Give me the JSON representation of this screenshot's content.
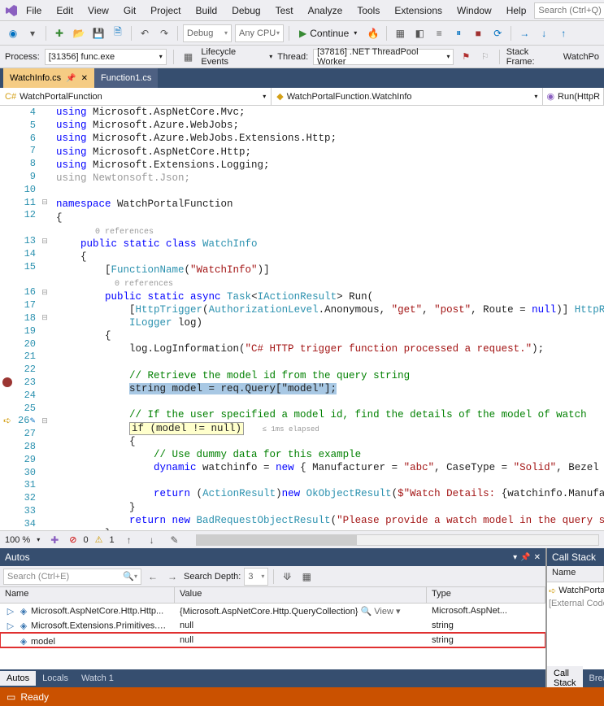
{
  "menu": {
    "items": [
      "File",
      "Edit",
      "View",
      "Git",
      "Project",
      "Build",
      "Debug",
      "Test",
      "Analyze",
      "Tools",
      "Extensions",
      "Window",
      "Help"
    ],
    "search_placeholder": "Search (Ctrl+Q)"
  },
  "toolbar": {
    "config": "Debug",
    "platform": "Any CPU",
    "continue": "Continue"
  },
  "process_row": {
    "process_lbl": "Process:",
    "process_val": "[31356] func.exe",
    "lifecycle": "Lifecycle Events",
    "thread_lbl": "Thread:",
    "thread_val": "[37816] .NET ThreadPool Worker",
    "stackframe_lbl": "Stack Frame:",
    "stackframe_val": "WatchPo"
  },
  "tabs": {
    "active": "WatchInfo.cs",
    "other": "Function1.cs"
  },
  "nav": {
    "left": "WatchPortalFunction",
    "mid": "WatchPortalFunction.WatchInfo",
    "right": "Run(HttpR"
  },
  "code": {
    "lines": [
      {
        "n": 4,
        "seg": [
          {
            "t": "using ",
            "c": "kw"
          },
          {
            "t": "Microsoft.AspNetCore.Mvc;"
          }
        ]
      },
      {
        "n": 5,
        "seg": [
          {
            "t": "using ",
            "c": "kw"
          },
          {
            "t": "Microsoft.Azure.WebJobs;"
          }
        ]
      },
      {
        "n": 6,
        "seg": [
          {
            "t": "using ",
            "c": "kw"
          },
          {
            "t": "Microsoft.Azure.WebJobs.Extensions.Http;"
          }
        ]
      },
      {
        "n": 7,
        "seg": [
          {
            "t": "using ",
            "c": "kw"
          },
          {
            "t": "Microsoft.AspNetCore.Http;"
          }
        ]
      },
      {
        "n": 8,
        "seg": [
          {
            "t": "using ",
            "c": "kw"
          },
          {
            "t": "Microsoft.Extensions.Logging;"
          }
        ]
      },
      {
        "n": 9,
        "seg": [
          {
            "t": "using ",
            "c": "faded"
          },
          {
            "t": "Newtonsoft.Json;",
            "c": "faded"
          }
        ]
      },
      {
        "n": 10,
        "seg": [
          {
            "t": ""
          }
        ]
      },
      {
        "n": 11,
        "fold": "-",
        "seg": [
          {
            "t": "namespace ",
            "c": "kw"
          },
          {
            "t": "WatchPortalFunction"
          }
        ]
      },
      {
        "n": 12,
        "seg": [
          {
            "t": "{"
          }
        ]
      },
      {
        "n": "",
        "lens": true,
        "seg": [
          {
            "t": "        0 references",
            "c": "ref-lens"
          }
        ]
      },
      {
        "n": 13,
        "fold": "-",
        "seg": [
          {
            "t": "    public static class ",
            "c": "kw"
          },
          {
            "t": "WatchInfo",
            "c": "type"
          }
        ]
      },
      {
        "n": 14,
        "seg": [
          {
            "t": "    {"
          }
        ]
      },
      {
        "n": 15,
        "seg": [
          {
            "t": "        ["
          },
          {
            "t": "FunctionName",
            "c": "type"
          },
          {
            "t": "("
          },
          {
            "t": "\"WatchInfo\"",
            "c": "str"
          },
          {
            "t": ")]"
          }
        ]
      },
      {
        "n": "",
        "lens": true,
        "seg": [
          {
            "t": "            0 references",
            "c": "ref-lens"
          }
        ]
      },
      {
        "n": 16,
        "fold": "-",
        "seg": [
          {
            "t": "        public static async ",
            "c": "kw"
          },
          {
            "t": "Task",
            "c": "type"
          },
          {
            "t": "<"
          },
          {
            "t": "IActionResult",
            "c": "type"
          },
          {
            "t": "> "
          },
          {
            "t": "Run",
            "c": ""
          },
          {
            "t": "("
          }
        ]
      },
      {
        "n": 17,
        "seg": [
          {
            "t": "            ["
          },
          {
            "t": "HttpTrigger",
            "c": "type"
          },
          {
            "t": "("
          },
          {
            "t": "AuthorizationLevel",
            "c": "type"
          },
          {
            "t": ".Anonymous, "
          },
          {
            "t": "\"get\"",
            "c": "str"
          },
          {
            "t": ", "
          },
          {
            "t": "\"post\"",
            "c": "str"
          },
          {
            "t": ", Route = "
          },
          {
            "t": "null",
            "c": "kw"
          },
          {
            "t": ")] "
          },
          {
            "t": "HttpReque",
            "c": "type"
          }
        ]
      },
      {
        "n": 18,
        "fold": "-",
        "seg": [
          {
            "t": "            "
          },
          {
            "t": "ILogger",
            "c": "type"
          },
          {
            "t": " log)"
          }
        ]
      },
      {
        "n": 19,
        "gb": true,
        "seg": [
          {
            "t": "        {"
          }
        ]
      },
      {
        "n": 20,
        "gb": true,
        "seg": [
          {
            "t": "            log.LogInformation("
          },
          {
            "t": "\"C# HTTP trigger function processed a request.\"",
            "c": "str"
          },
          {
            "t": ");"
          }
        ]
      },
      {
        "n": 21,
        "gb": true,
        "seg": [
          {
            "t": ""
          }
        ]
      },
      {
        "n": 22,
        "gb": true,
        "seg": [
          {
            "t": "            "
          },
          {
            "t": "// Retrieve the model id from the query string",
            "c": "cm"
          }
        ]
      },
      {
        "n": 23,
        "gb": true,
        "bp": true,
        "hl": true,
        "seg": [
          {
            "t": "            "
          },
          {
            "t": "string model = req.Query[\"model\"];",
            "c": "highlight-line"
          }
        ]
      },
      {
        "n": 24,
        "gb": true,
        "seg": [
          {
            "t": ""
          }
        ]
      },
      {
        "n": 25,
        "gb": true,
        "seg": [
          {
            "t": "            "
          },
          {
            "t": "// If the user specified a model id, find the details of the model of watch",
            "c": "cm"
          }
        ]
      },
      {
        "n": 26,
        "gb": true,
        "cur": true,
        "fold": "-",
        "seg": [
          {
            "t": "            "
          },
          {
            "t": "if (model != null)",
            "c": "yellow-box"
          },
          {
            "t": "   "
          },
          {
            "t": "≤ 1ms elapsed",
            "c": "elapsed"
          }
        ]
      },
      {
        "n": 27,
        "gb": true,
        "seg": [
          {
            "t": "            {"
          }
        ]
      },
      {
        "n": 28,
        "gb": true,
        "seg": [
          {
            "t": "                "
          },
          {
            "t": "// Use dummy data for this example",
            "c": "cm"
          }
        ]
      },
      {
        "n": 29,
        "gb": true,
        "seg": [
          {
            "t": "                "
          },
          {
            "t": "dynamic",
            "c": "kw"
          },
          {
            "t": " watchinfo = "
          },
          {
            "t": "new",
            "c": "kw"
          },
          {
            "t": " { Manufacturer = "
          },
          {
            "t": "\"abc\"",
            "c": "str"
          },
          {
            "t": ", CaseType = "
          },
          {
            "t": "\"Solid\"",
            "c": "str"
          },
          {
            "t": ", Bezel = "
          },
          {
            "t": "\"T",
            "c": "str"
          }
        ]
      },
      {
        "n": 30,
        "gb": true,
        "seg": [
          {
            "t": ""
          }
        ]
      },
      {
        "n": 31,
        "gb": true,
        "seg": [
          {
            "t": "                "
          },
          {
            "t": "return",
            "c": "kw"
          },
          {
            "t": " ("
          },
          {
            "t": "ActionResult",
            "c": "type"
          },
          {
            "t": ")"
          },
          {
            "t": "new ",
            "c": "kw"
          },
          {
            "t": "OkObjectResult",
            "c": "type"
          },
          {
            "t": "("
          },
          {
            "t": "$\"Watch Details: ",
            "c": "str"
          },
          {
            "t": "{watchinfo.Manufactur"
          }
        ]
      },
      {
        "n": 32,
        "gb": true,
        "seg": [
          {
            "t": "            }"
          }
        ]
      },
      {
        "n": 33,
        "gb": true,
        "seg": [
          {
            "t": "            "
          },
          {
            "t": "return new ",
            "c": "kw"
          },
          {
            "t": "BadRequestObjectResult",
            "c": "type"
          },
          {
            "t": "("
          },
          {
            "t": "\"Please provide a watch model in the query strin",
            "c": "str"
          }
        ]
      },
      {
        "n": 34,
        "seg": [
          {
            "t": "        }"
          }
        ]
      }
    ]
  },
  "ed_foot": {
    "zoom": "100 %",
    "err": "0",
    "warn": "1"
  },
  "autos": {
    "title": "Autos",
    "search_ph": "Search (Ctrl+E)",
    "depth_lbl": "Search Depth:",
    "depth_val": "3",
    "cols": [
      "Name",
      "Value",
      "Type"
    ],
    "rows": [
      {
        "name": "Microsoft.AspNetCore.Http.Http...",
        "val": "{Microsoft.AspNetCore.Http.QueryCollection}",
        "type": "Microsoft.AspNet...",
        "view": true,
        "exp": true
      },
      {
        "name": "Microsoft.Extensions.Primitives.S...",
        "val": "null",
        "type": "string",
        "exp": true
      },
      {
        "name": "model",
        "val": "null",
        "type": "string",
        "hl": true,
        "exp": false
      }
    ],
    "tabs": [
      "Autos",
      "Locals",
      "Watch 1"
    ]
  },
  "callstack": {
    "title": "Call Stack",
    "col": "Name",
    "rows": [
      {
        "ico": "arrow",
        "t": "WatchPortalFu"
      },
      {
        "ico": "",
        "t": "[External Code"
      }
    ],
    "tabs": [
      "Call Stack",
      "Break"
    ]
  },
  "status": {
    "text": "Ready"
  }
}
